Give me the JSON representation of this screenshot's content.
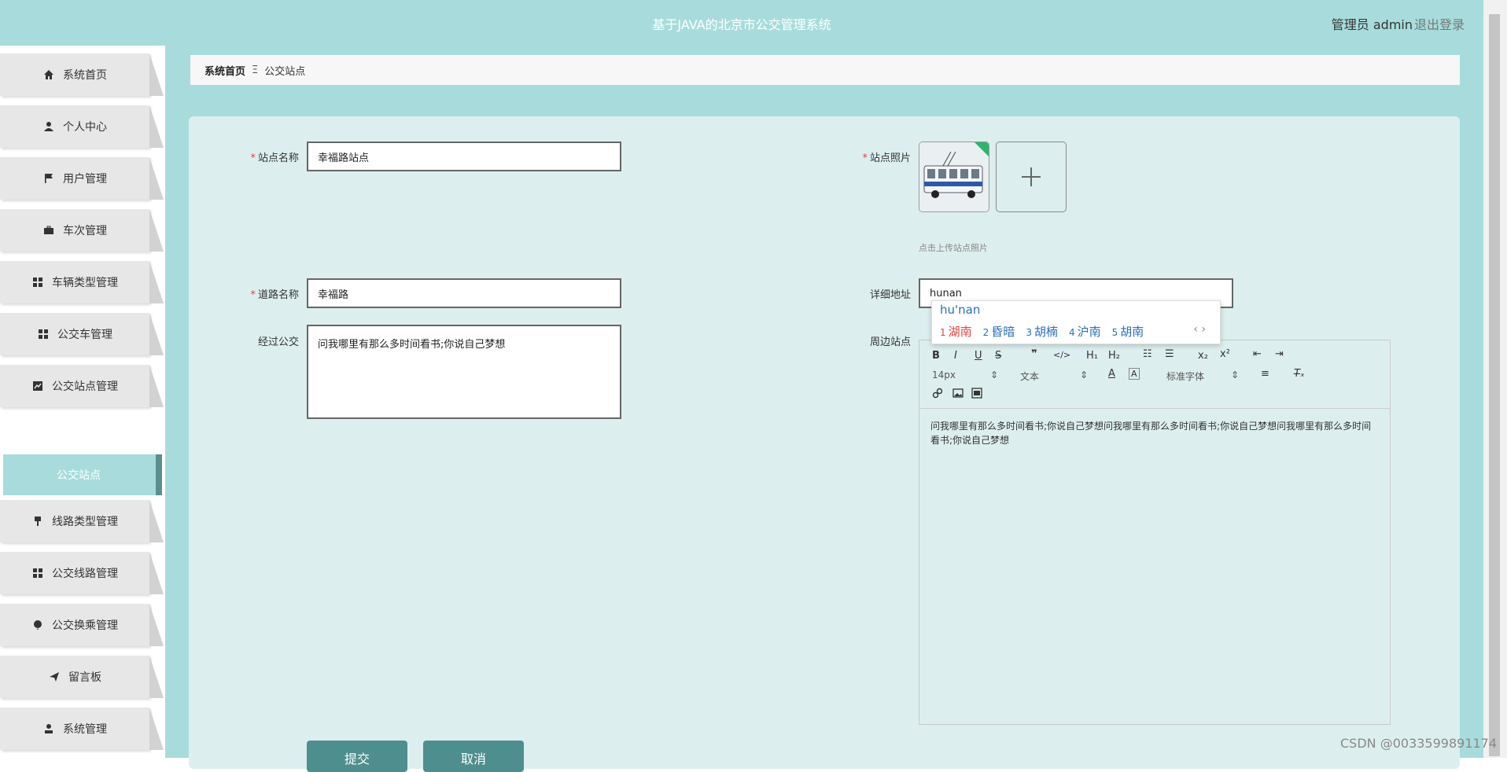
{
  "header": {
    "title": "基于JAVA的北京市公交管理系统",
    "user_label": "管理员 admin",
    "logout_label": "退出登录"
  },
  "sidebar": {
    "items": [
      {
        "label": "系统首页",
        "icon": "home-icon"
      },
      {
        "label": "个人中心",
        "icon": "user-icon"
      },
      {
        "label": "用户管理",
        "icon": "flag-icon"
      },
      {
        "label": "车次管理",
        "icon": "briefcase-icon"
      },
      {
        "label": "车辆类型管理",
        "icon": "grid-icon"
      },
      {
        "label": "公交车管理",
        "icon": "grid-icon"
      },
      {
        "label": "公交站点管理",
        "icon": "chart-icon"
      },
      {
        "label": "线路类型管理",
        "icon": "brush-icon"
      },
      {
        "label": "公交线路管理",
        "icon": "grid-icon"
      },
      {
        "label": "公交换乘管理",
        "icon": "balloon-icon"
      },
      {
        "label": "留言板",
        "icon": "send-icon"
      },
      {
        "label": "系统管理",
        "icon": "user-icon"
      }
    ],
    "active_sub": "公交站点"
  },
  "breadcrumb": {
    "home": "系统首页",
    "separator": "Ξ",
    "current": "公交站点"
  },
  "form": {
    "station_name": {
      "label": "站点名称",
      "value": "幸福路站点"
    },
    "station_photo": {
      "label": "站点照片",
      "hint": "点击上传站点照片"
    },
    "road_name": {
      "label": "道路名称",
      "value": "幸福路"
    },
    "address": {
      "label": "详细地址",
      "value": "hunan"
    },
    "passing_bus": {
      "label": "经过公交",
      "value": "问我哪里有那么多时间看书;你说自己梦想"
    },
    "nearby": {
      "label": "周边站点",
      "content": "问我哪里有那么多时间看书;你说自己梦想问我哪里有那么多时间看书;你说自己梦想问我哪里有那么多时间看书;你说自己梦想"
    },
    "submit_label": "提交",
    "cancel_label": "取消"
  },
  "ime": {
    "pinyin": "hu'nan",
    "candidates": [
      {
        "num": "1",
        "text": "湖南"
      },
      {
        "num": "2",
        "text": "昏暗"
      },
      {
        "num": "3",
        "text": "胡楠"
      },
      {
        "num": "4",
        "text": "沪南"
      },
      {
        "num": "5",
        "text": "胡南"
      }
    ]
  },
  "editor": {
    "font_size": "14px",
    "format": "文本",
    "font_family": "标准字体"
  },
  "watermark": "CSDN @0033599891174",
  "colors": {
    "header_bg": "#a8dcdc",
    "panel_bg": "#dcefee",
    "button_bg": "#4e8e8e",
    "required": "#e64242"
  }
}
